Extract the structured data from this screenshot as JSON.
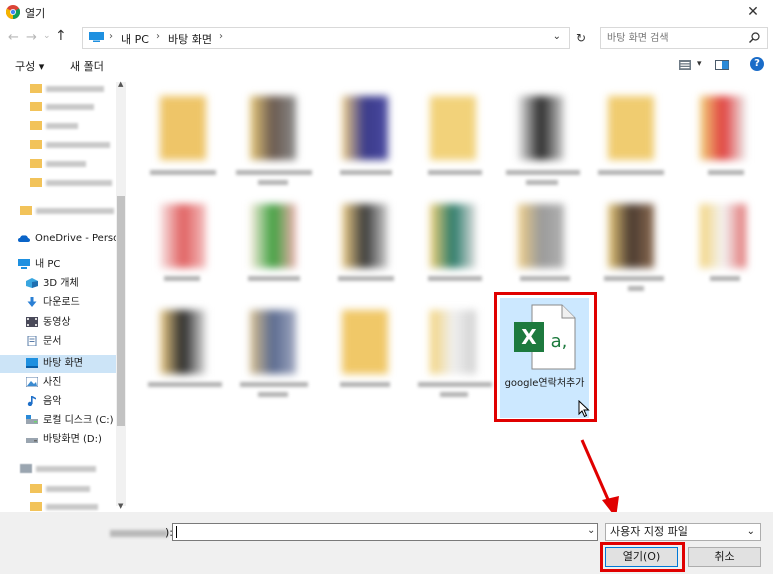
{
  "window": {
    "title": "열기",
    "close_glyph": "✕"
  },
  "address": {
    "crumbs": [
      "내 PC",
      "바탕 화면"
    ],
    "separator": "›",
    "dropdown_glyph": "⌄",
    "refresh_glyph": "↻"
  },
  "search": {
    "placeholder": "바탕 화면 검색"
  },
  "toolbar": {
    "organize_label": "구성 ▾",
    "new_folder_label": "새 폴더",
    "help_label": "?"
  },
  "nav": {
    "onedrive": "OneDrive - Person",
    "this_pc": "내 PC",
    "items": [
      {
        "label": "3D 개체",
        "icon": "3d-objects-icon"
      },
      {
        "label": "다운로드",
        "icon": "downloads-icon"
      },
      {
        "label": "동영상",
        "icon": "videos-icon"
      },
      {
        "label": "문서",
        "icon": "documents-icon"
      },
      {
        "label": "바탕 화면",
        "icon": "desktop-icon",
        "selected": true
      },
      {
        "label": "사진",
        "icon": "pictures-icon"
      },
      {
        "label": "음악",
        "icon": "music-icon"
      },
      {
        "label": "로컬 디스크 (C:)",
        "icon": "local-disk-icon"
      },
      {
        "label": "바탕화면 (D:)",
        "icon": "drive-icon"
      }
    ]
  },
  "content": {
    "highlighted_file": {
      "name": "google연락처추가",
      "type_badge_x": "X",
      "type_badge_a": "a,"
    }
  },
  "bottom": {
    "filename_colon": "):",
    "filename_value": "",
    "filetype_selected": "사용자 지정 파일",
    "open_label": "열기(O)",
    "cancel_label": "취소"
  },
  "colors": {
    "accent": "#0078d7",
    "highlight_red": "#e00000",
    "selection": "#cce8ff",
    "excel_green": "#1d7a3e"
  }
}
